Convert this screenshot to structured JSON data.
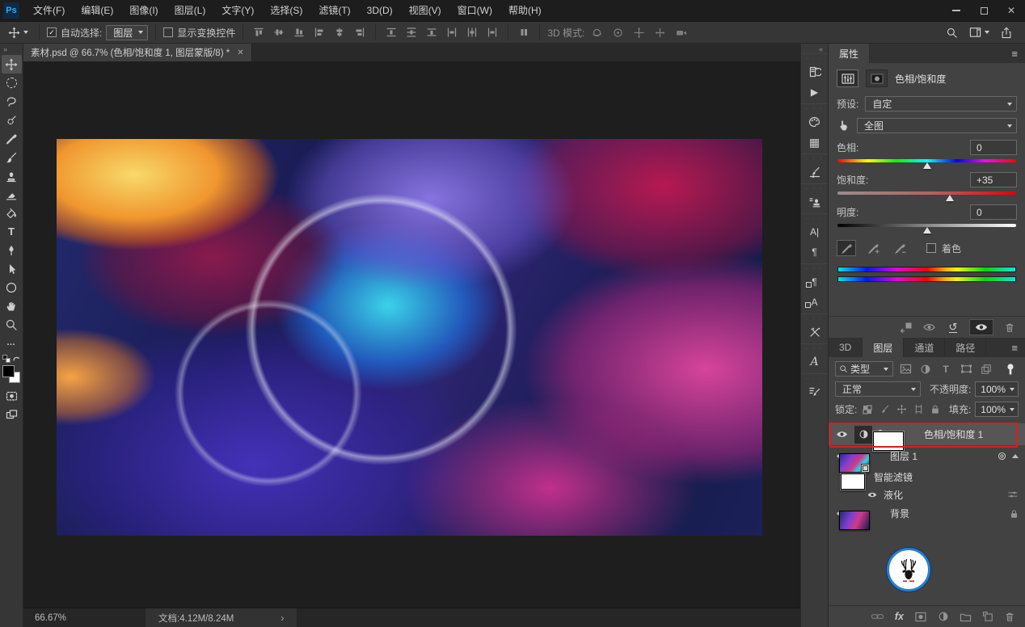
{
  "app": {
    "logo_text": "Ps"
  },
  "colors": {
    "annotation_red": "#e3191c",
    "ps_logo_blue": "#36a7ec",
    "canvas_bg": "#1e1e1e",
    "selected_layer_bg": "#565656",
    "watermark_ring_blue": "#2b7fd0"
  },
  "icons": {
    "check": "✓",
    "close": "✕",
    "panel_menu": "≡",
    "ellipsis": "…",
    "type_tool": "T",
    "character": "A|",
    "paragraph": "¶",
    "paragraph_styles": "¶",
    "character_styles": "A",
    "glyphs": "A",
    "history": "↺",
    "reset": "↺",
    "actions": "▶",
    "swatches": "▦",
    "adjustment_half_circle": "◐",
    "fx": "fx",
    "chevron_right": "›",
    "double_arrow_right": "»",
    "double_arrow_left": "«",
    "dock_handle": "· · ·"
  },
  "menu_bar": {
    "items": [
      "文件(F)",
      "编辑(E)",
      "图像(I)",
      "图层(L)",
      "文字(Y)",
      "选择(S)",
      "滤镜(T)",
      "3D(D)",
      "视图(V)",
      "窗口(W)",
      "帮助(H)"
    ]
  },
  "options_bar": {
    "auto_select_label": "自动选择:",
    "auto_select_value": "图层",
    "show_transform_label": "显示变换控件",
    "mode_3d_label": "3D 模式:"
  },
  "document_tab": {
    "title": "素材.psd @ 66.7% (色相/饱和度 1, 图层蒙版/8) *"
  },
  "properties_panel": {
    "tab": "属性",
    "adjustment_title": "色相/饱和度",
    "preset_label": "预设:",
    "preset_value": "自定",
    "channel_value": "全图",
    "hue_label": "色相:",
    "hue_value": "0",
    "saturation_label": "饱和度:",
    "saturation_value": "+35",
    "lightness_label": "明度:",
    "lightness_value": "0",
    "colorize_label": "着色"
  },
  "layers_panel": {
    "tabs": [
      "3D",
      "图层",
      "通道",
      "路径"
    ],
    "filter_kind_value": "类型",
    "blend_mode_value": "正常",
    "opacity_label": "不透明度:",
    "opacity_value": "100%",
    "lock_label": "锁定:",
    "fill_label": "填充:",
    "fill_value": "100%",
    "layers": [
      {
        "name": "色相/饱和度 1",
        "type": "adjustment-layer",
        "annotated": true
      },
      {
        "name": "图层 1",
        "type": "smart-object"
      },
      {
        "name": "智能滤镜",
        "type": "smart-filters-mask"
      },
      {
        "name": "液化",
        "type": "smart-filter"
      },
      {
        "name": "背景",
        "type": "background-locked"
      }
    ]
  },
  "status_bar": {
    "zoom_level": "66.67%",
    "doc_info": "文档:4.12M/8.24M"
  }
}
